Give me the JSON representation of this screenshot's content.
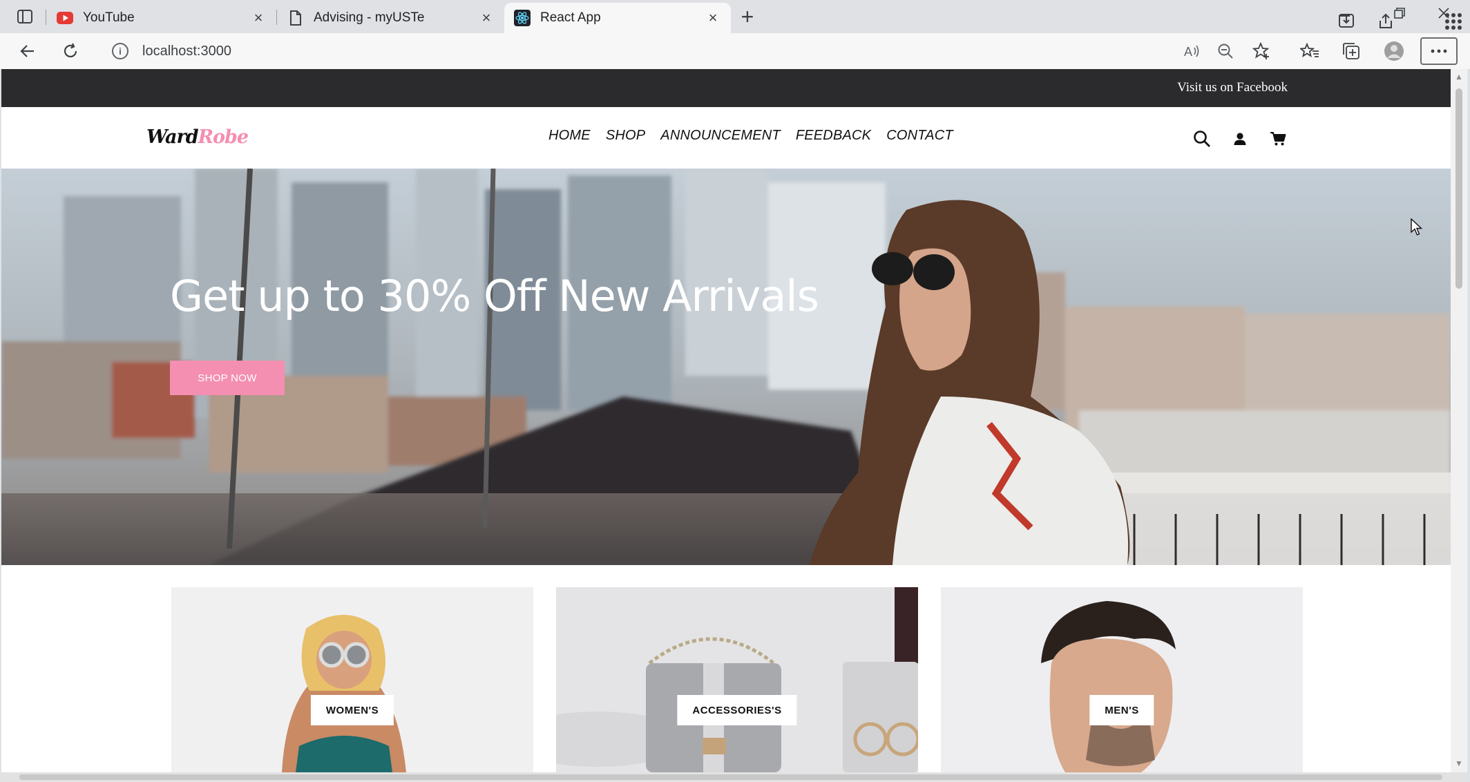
{
  "browser": {
    "tabs": [
      {
        "title": "YouTube",
        "icon": "youtube-icon",
        "active": false
      },
      {
        "title": "Advising - myUSTe",
        "icon": "page-icon",
        "active": false
      },
      {
        "title": "React App",
        "icon": "react-icon",
        "active": true
      }
    ],
    "url": "localhost:3000"
  },
  "site": {
    "topbar_link": "Visit us on Facebook",
    "logo": {
      "part1": "Ward",
      "part2": "Robe"
    },
    "nav": [
      "HOME",
      "SHOP",
      "ANNOUNCEMENT",
      "FEEDBACK",
      "CONTACT"
    ],
    "hero": {
      "title": "Get up to 30% Off New Arrivals",
      "button": "SHOP NOW"
    },
    "categories": [
      {
        "label": "WOMEN'S"
      },
      {
        "label": "ACCESSORIES'S"
      },
      {
        "label": "MEN'S"
      }
    ]
  },
  "colors": {
    "accent": "#f48fb1",
    "topbar": "#2b2a2d"
  }
}
